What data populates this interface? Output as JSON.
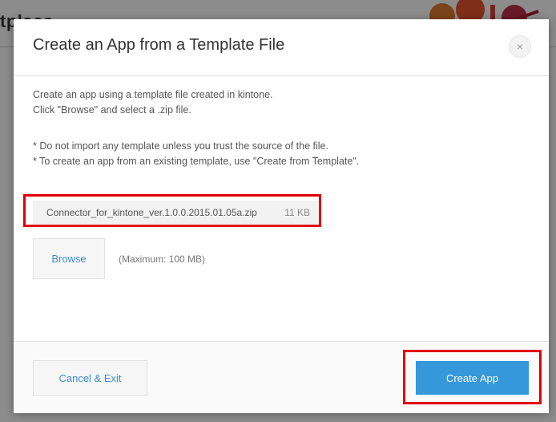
{
  "background": {
    "page_title_fragment": "tplace"
  },
  "dialog": {
    "title": "Create an App from a Template File",
    "close_glyph": "×",
    "description_lines": [
      "Create an app using a template file created in kintone.",
      "Click \"Browse\" and select a .zip file.",
      "* Do not import any template unless you trust the source of the file.",
      "* To create an app from an existing template, use \"Create from Template\"."
    ],
    "file": {
      "name": "Connector_for_kintone_ver.1.0.0.2015.01.05a.zip",
      "size": "11 KB"
    },
    "browse_label": "Browse",
    "max_size_note": "(Maximum: 100 MB)",
    "cancel_label": "Cancel & Exit",
    "create_label": "Create App"
  },
  "colors": {
    "accent": "#3498db",
    "link": "#3a8ed8",
    "highlight": "#e00000"
  },
  "icons": {
    "close": "close-icon"
  }
}
